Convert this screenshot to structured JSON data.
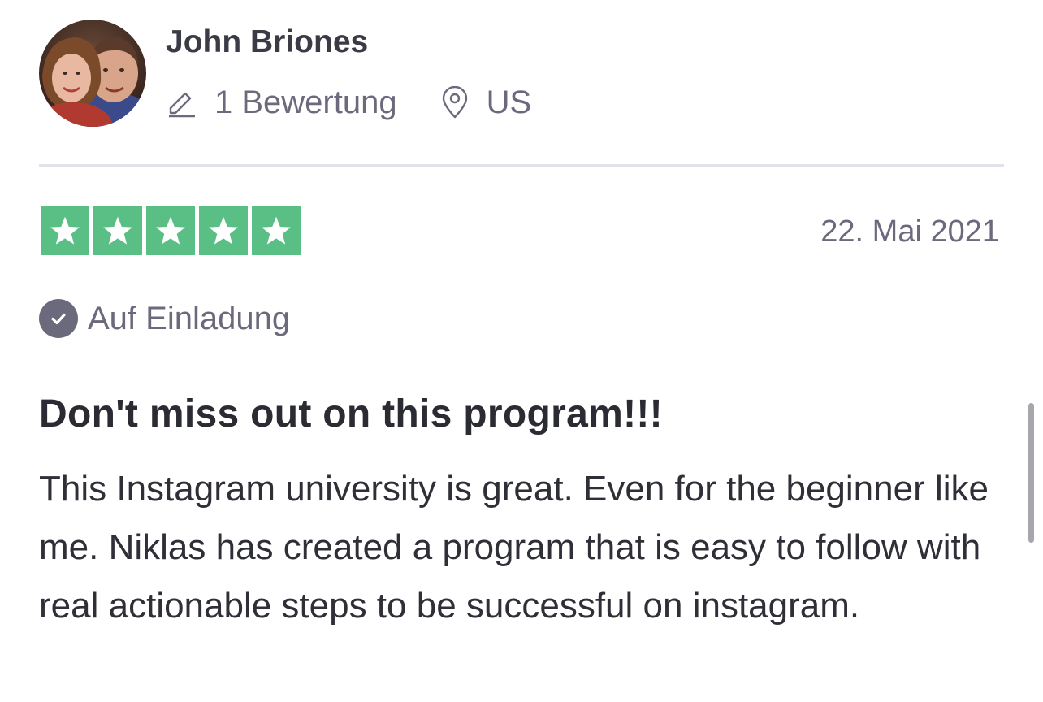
{
  "reviewer": {
    "name": "John Briones",
    "reviews_count": "1 Bewertung",
    "country": "US"
  },
  "rating": {
    "stars": 5,
    "star_color": "#5abf84"
  },
  "review": {
    "date": "22. Mai 2021",
    "invite_label": "Auf Einladung",
    "title": "Don't miss out on this program!!!",
    "body": "This Instagram university is great. Even for the beginner like me. Niklas has created a program that is easy to follow with real actionable steps to be successful on instagram."
  },
  "icons": {
    "reviews": "pencil-icon",
    "location": "location-pin-icon",
    "invite": "checkmark-circle-icon",
    "star": "star-icon"
  },
  "colors": {
    "muted_text": "#6b6a7d",
    "heading_text": "#2b2b33",
    "divider": "#e2e2ea"
  }
}
